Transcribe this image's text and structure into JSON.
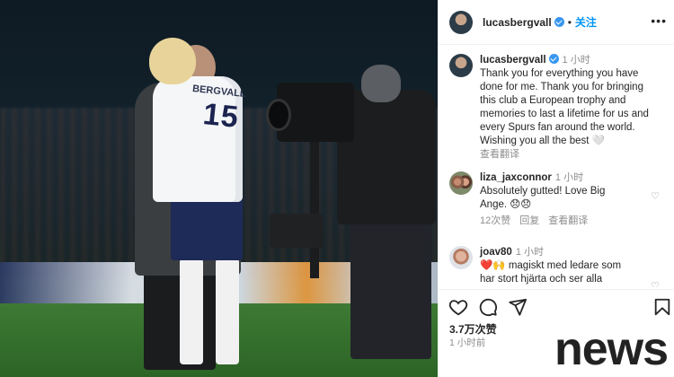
{
  "watermark": "news",
  "photo": {
    "shirt_name": "BERGVALL",
    "shirt_number": "15"
  },
  "header": {
    "username": "lucasbergvall",
    "separator": "•",
    "follow_label": "关注",
    "more_icon": "more-horizontal-icon"
  },
  "caption": {
    "username": "lucasbergvall",
    "time": "1 小时",
    "text": "Thank you for everything you have done for me. Thank you for bringing this club a European trophy and memories to last a lifetime for us and every Spurs fan around the world. Wishing you all the best 🤍",
    "translate": "查看翻译"
  },
  "comments": [
    {
      "username": "liza_jaxconnor",
      "time": "1 小时",
      "text": "Absolutely gutted! Love Big Ange. 😞😞",
      "likes": "12次赞",
      "reply": "回复",
      "translate": "查看翻译"
    },
    {
      "username": "joav80",
      "time": "1 小时",
      "text": "❤️🙌 magiskt med ledare som har stort hjärta och ser alla"
    }
  ],
  "actions": {
    "like_icon": "heart-icon",
    "comment_icon": "comment-icon",
    "share_icon": "send-icon",
    "save_icon": "bookmark-icon"
  },
  "likes_count": "3.7万次赞",
  "posted_ago": "1 小时前",
  "colors": {
    "link": "#0095f6",
    "verified": "#3897f0",
    "muted": "#8e8e8e",
    "text": "#262626"
  }
}
